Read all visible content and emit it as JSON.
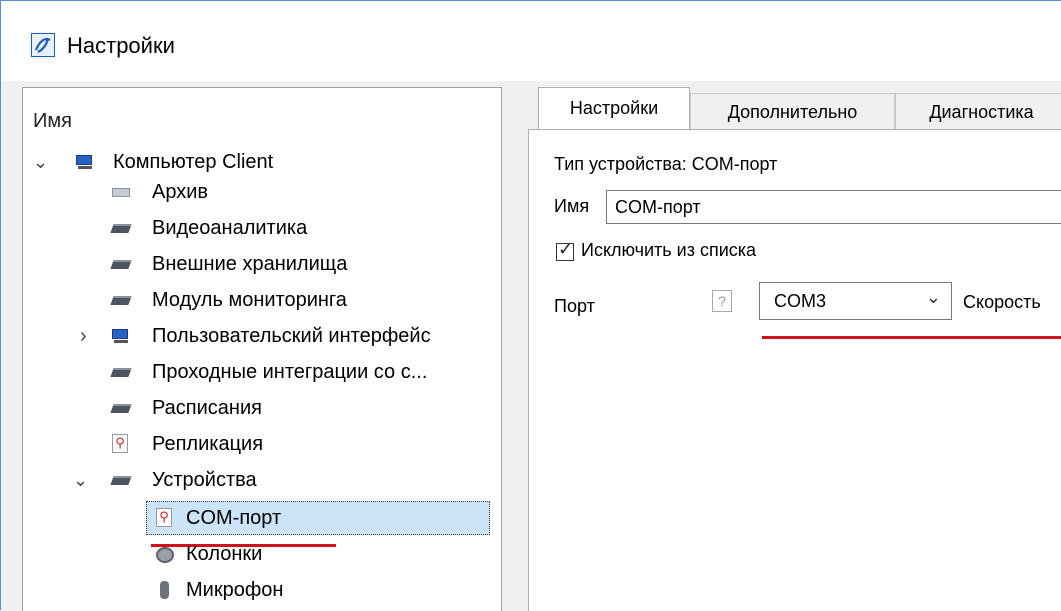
{
  "window": {
    "title": "Настройки"
  },
  "tree": {
    "header": "Имя",
    "items": [
      {
        "label": "Компьютер Client",
        "icon": "computer-icon",
        "expanded": true
      },
      {
        "label": "Архив",
        "icon": "archive-icon"
      },
      {
        "label": "Видеоаналитика",
        "icon": "server-icon"
      },
      {
        "label": "Внешние хранилища",
        "icon": "server-icon"
      },
      {
        "label": "Модуль мониторинга",
        "icon": "server-icon"
      },
      {
        "label": "Пользовательский интерфейс",
        "icon": "monitor-icon",
        "expanded": false
      },
      {
        "label": "Проходные интеграции со с...",
        "icon": "server-icon"
      },
      {
        "label": "Расписания",
        "icon": "server-icon"
      },
      {
        "label": "Репликация",
        "icon": "antenna-icon"
      },
      {
        "label": "Устройства",
        "icon": "server-icon",
        "expanded": true
      },
      {
        "label": "COM-порт",
        "icon": "antenna-icon",
        "selected": true
      },
      {
        "label": "Колонки",
        "icon": "speaker-icon"
      },
      {
        "label": "Микрофон",
        "icon": "microphone-icon"
      }
    ]
  },
  "tabs": [
    {
      "label": "Настройки",
      "active": true
    },
    {
      "label": "Дополнительно",
      "active": false
    },
    {
      "label": "Диагностика",
      "active": false
    }
  ],
  "settings": {
    "device_type": "Тип устройства: COM-порт",
    "name_label": "Имя",
    "name_value": "COM-порт",
    "exclude_label": "Исключить из списка",
    "exclude_checked": true,
    "port_label": "Порт",
    "port_help": "?",
    "port_value": "COM3",
    "speed_label": "Скорость"
  },
  "colors": {
    "selection": "#cce4f7",
    "highlight_underline": "#d0121c",
    "window_border": "#5a8fd4"
  }
}
